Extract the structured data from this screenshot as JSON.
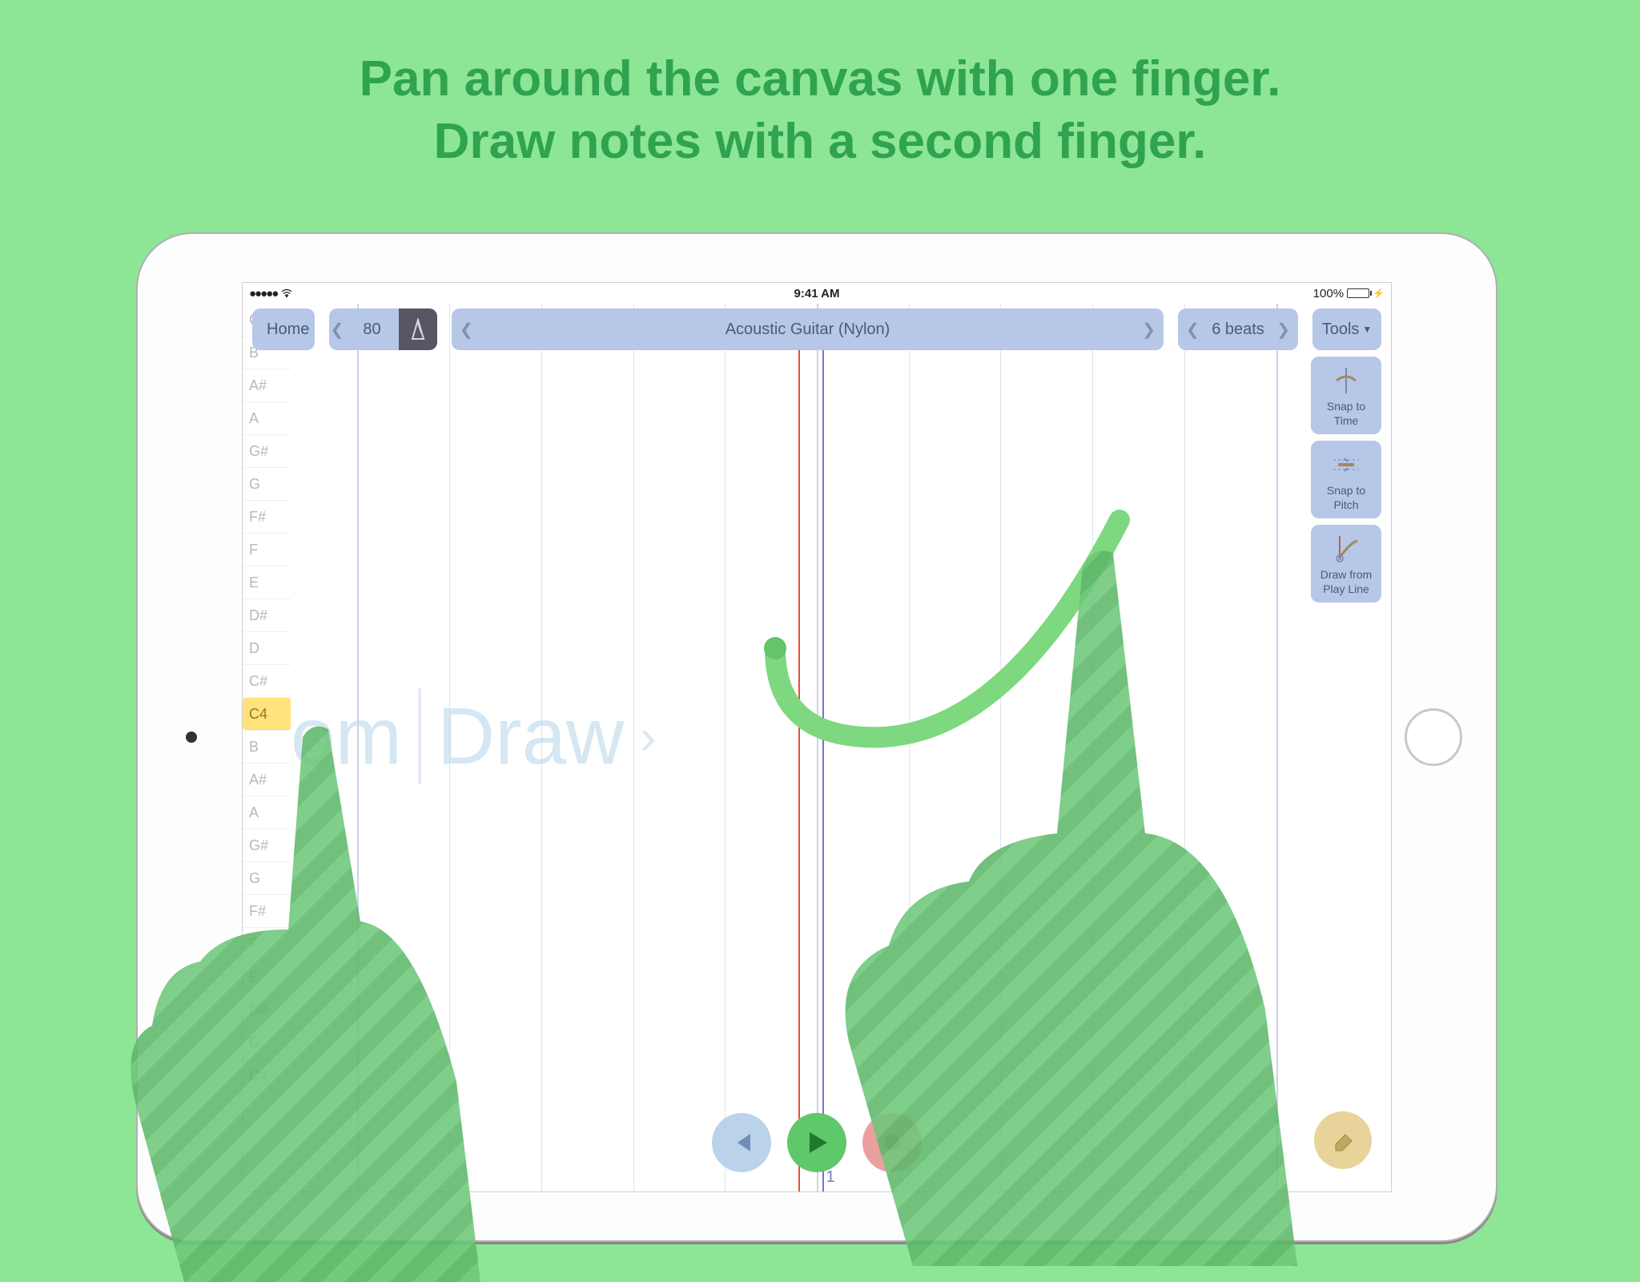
{
  "headline": {
    "line1": "Pan around the canvas with one finger.",
    "line2": "Draw notes with a second finger."
  },
  "status": {
    "time": "9:41 AM",
    "battery": "100%"
  },
  "toolbar": {
    "home": "Home",
    "tempo": "80",
    "instrument": "Acoustic Guitar (Nylon)",
    "beats": "6 beats",
    "tools": "Tools"
  },
  "side": {
    "snap_time": "Snap to Time",
    "snap_pitch": "Snap to Pitch",
    "draw_line": "Draw from Play Line"
  },
  "watermark": {
    "left": "om",
    "right": "Draw"
  },
  "pitches": [
    "C",
    "B",
    "A#",
    "A",
    "G#",
    "G",
    "F#",
    "F",
    "E",
    "D#",
    "D",
    "C#",
    "C4",
    "B",
    "A#",
    "A",
    "G#",
    "G",
    "F#",
    "F",
    "E",
    "D#",
    "D",
    "C#"
  ],
  "beat_number": "1"
}
